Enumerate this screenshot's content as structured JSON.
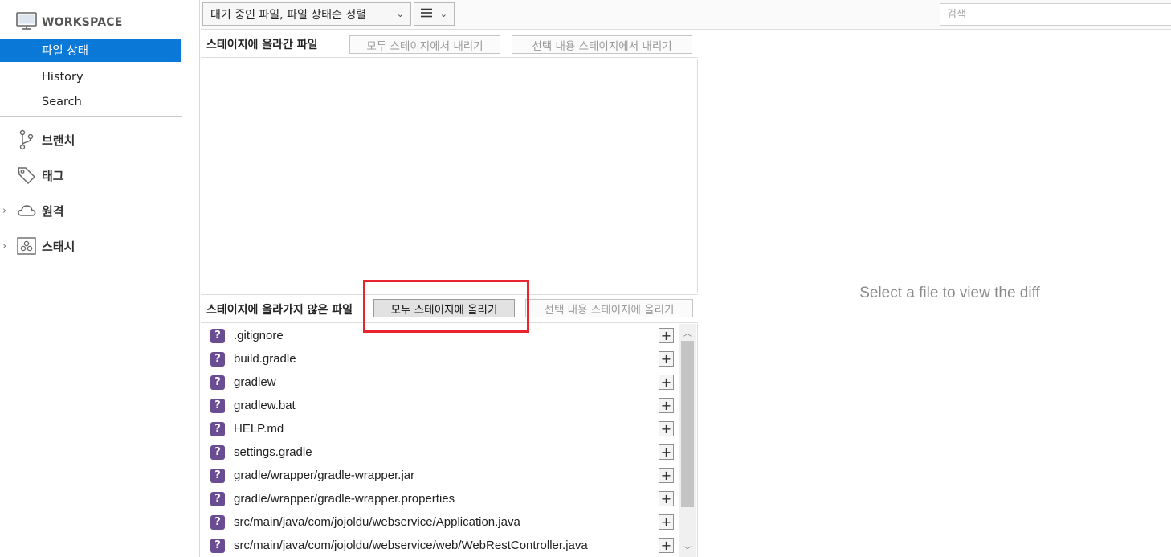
{
  "sidebar": {
    "workspace_label": "WORKSPACE",
    "nav": [
      {
        "label": "파일 상태",
        "selected": true
      },
      {
        "label": "History",
        "selected": false
      },
      {
        "label": "Search",
        "selected": false
      }
    ],
    "groups": [
      {
        "label": "브랜치",
        "icon": "branch-icon",
        "expandable": false
      },
      {
        "label": "태그",
        "icon": "tag-icon",
        "expandable": false
      },
      {
        "label": "원격",
        "icon": "cloud-icon",
        "expandable": true
      },
      {
        "label": "스태시",
        "icon": "stash-icon",
        "expandable": true
      }
    ]
  },
  "toolbar": {
    "sort_value": "대기 중인 파일, 파일 상태순 정렬",
    "search_placeholder": "검색"
  },
  "staged": {
    "title": "스테이지에 올라간 파일",
    "unstage_all_label": "모두 스테이지에서 내리기",
    "unstage_selected_label": "선택 내용 스테이지에서 내리기",
    "files": []
  },
  "unstaged": {
    "title": "스테이지에 올라가지 않은 파일",
    "stage_all_label": "모두 스테이지에 올리기",
    "stage_selected_label": "선택 내용 스테이지에 올리기",
    "files": [
      ".gitignore",
      "build.gradle",
      "gradlew",
      "gradlew.bat",
      "HELP.md",
      "settings.gradle",
      "gradle/wrapper/gradle-wrapper.jar",
      "gradle/wrapper/gradle-wrapper.properties",
      "src/main/java/com/jojoldu/webservice/Application.java",
      "src/main/java/com/jojoldu/webservice/web/WebRestController.java"
    ],
    "status_icon": "question-icon",
    "status_color": "#6a4c93"
  },
  "diff": {
    "empty_message": "Select a file to view the diff"
  },
  "colors": {
    "accent": "#0a78d7",
    "highlight": "#e8242c"
  }
}
